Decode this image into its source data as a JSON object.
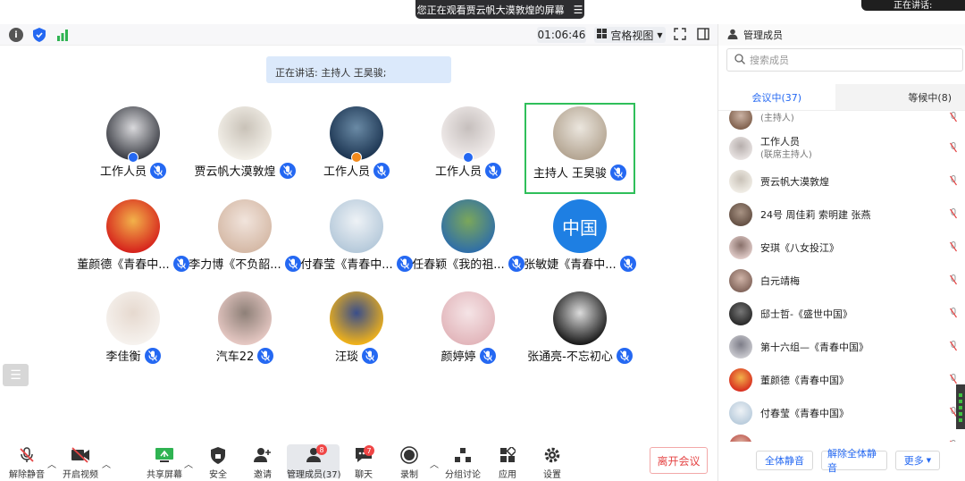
{
  "banner": {
    "text": "您正在观看贾云帆大漠敦煌的屏幕",
    "corner_text": "正在讲话:"
  },
  "topbar": {
    "timer": "01:06:46",
    "view_label": "宫格视图"
  },
  "speaking": {
    "text": "正在讲话: 主持人 王昊骏;"
  },
  "participants": [
    {
      "name": "工作人员",
      "host": true,
      "color1": "#3d3f46",
      "color2": "#d9d9dc"
    },
    {
      "name": "贾云帆大漠敦煌",
      "host": false,
      "color1": "#f4f1ea",
      "color2": "#c9c2b8"
    },
    {
      "name": "工作人员",
      "host": true,
      "host_color": "#f38a1c",
      "color1": "#1c3552",
      "color2": "#6a8aa5"
    },
    {
      "name": "工作人员",
      "host": true,
      "color1": "#f1eceb",
      "color2": "#c6bfbd"
    },
    {
      "name": "主持人 王昊骏",
      "host": false,
      "active": true,
      "color1": "#b4a592",
      "color2": "#ebe6de"
    },
    {
      "name": "董颜德《青春中...",
      "host": false,
      "color1": "#d6231c",
      "color2": "#f2b24a"
    },
    {
      "name": "李力博《不负韶...",
      "host": false,
      "color1": "#d5b9a6",
      "color2": "#f1e4dc"
    },
    {
      "name": "付春莹《青春中...",
      "host": false,
      "color1": "#b5c9da",
      "color2": "#eef2f6"
    },
    {
      "name": "任春颖《我的祖...",
      "host": false,
      "color1": "#2f6ea8",
      "color2": "#7ba75a"
    },
    {
      "name": "张敏婕《青春中...",
      "host": false,
      "text_avatar": "中国",
      "color1": "#1e7fe3",
      "color2": "#1e7fe3"
    },
    {
      "name": "李佳衡",
      "host": false,
      "color1": "#f6f2ee",
      "color2": "#e6d9cf"
    },
    {
      "name": "汽车22",
      "host": false,
      "color1": "#e6c8c3",
      "color2": "#8e8078"
    },
    {
      "name": "汪琰",
      "host": false,
      "color1": "#f0b21a",
      "color2": "#3a4e8a"
    },
    {
      "name": "颜婷婷",
      "host": false,
      "color1": "#e2b6bb",
      "color2": "#f5e4e6"
    },
    {
      "name": "张通亮-不忘初心",
      "host": false,
      "color1": "#1a1a1a",
      "color2": "#dcdcdc"
    }
  ],
  "toolbar": {
    "unmute": "解除静音",
    "start_video": "开启视频",
    "share_screen": "共享屏幕",
    "security": "安全",
    "invite": "邀请",
    "manage_members": "管理成员(37)",
    "manage_badge": "8",
    "chat": "聊天",
    "chat_badge": "7",
    "record": "录制",
    "breakout": "分组讨论",
    "apps": "应用",
    "settings": "设置",
    "leave": "离开会议"
  },
  "panel": {
    "title": "管理成员",
    "search_placeholder": "搜索成员",
    "tab_in_meeting": "会议中(37)",
    "tab_waiting": "等候中(8)",
    "members": [
      {
        "name": "",
        "sub": "(主持人)",
        "color1": "#7a5a46",
        "color2": "#cbb3a4"
      },
      {
        "name": "工作人员",
        "sub": "(联席主持人)",
        "color1": "#ece7e6",
        "color2": "#b6aeac"
      },
      {
        "name": "贾云帆大漠敦煌",
        "sub": "",
        "color1": "#f4f1ea",
        "color2": "#c9c2b8"
      },
      {
        "name": "24号 周佳莉 索明建 张燕",
        "sub": "",
        "color1": "#5e4a3e",
        "color2": "#a89384"
      },
      {
        "name": "安琪《八女投江》",
        "sub": "",
        "color1": "#e7d2cf",
        "color2": "#88706a"
      },
      {
        "name": "白元靖梅",
        "sub": "",
        "color1": "#7c5f55",
        "color2": "#d0b4a8"
      },
      {
        "name": "邸士哲-《盛世中国》",
        "sub": "",
        "color1": "#222222",
        "color2": "#777777"
      },
      {
        "name": "第十六组—《青春中国》",
        "sub": "",
        "color1": "#cfcfd4",
        "color2": "#7d7d88"
      },
      {
        "name": "董颜德《青春中国》",
        "sub": "",
        "color1": "#d6231c",
        "color2": "#f2b24a"
      },
      {
        "name": "付春莹《青春中国》",
        "sub": "",
        "color1": "#b5c9da",
        "color2": "#eef2f6"
      },
      {
        "name": "",
        "sub": "",
        "color1": "#b8423b",
        "color2": "#e0b9a8"
      }
    ],
    "mute_all": "全体静音",
    "unmute_all": "解除全体静音",
    "more": "更多"
  }
}
